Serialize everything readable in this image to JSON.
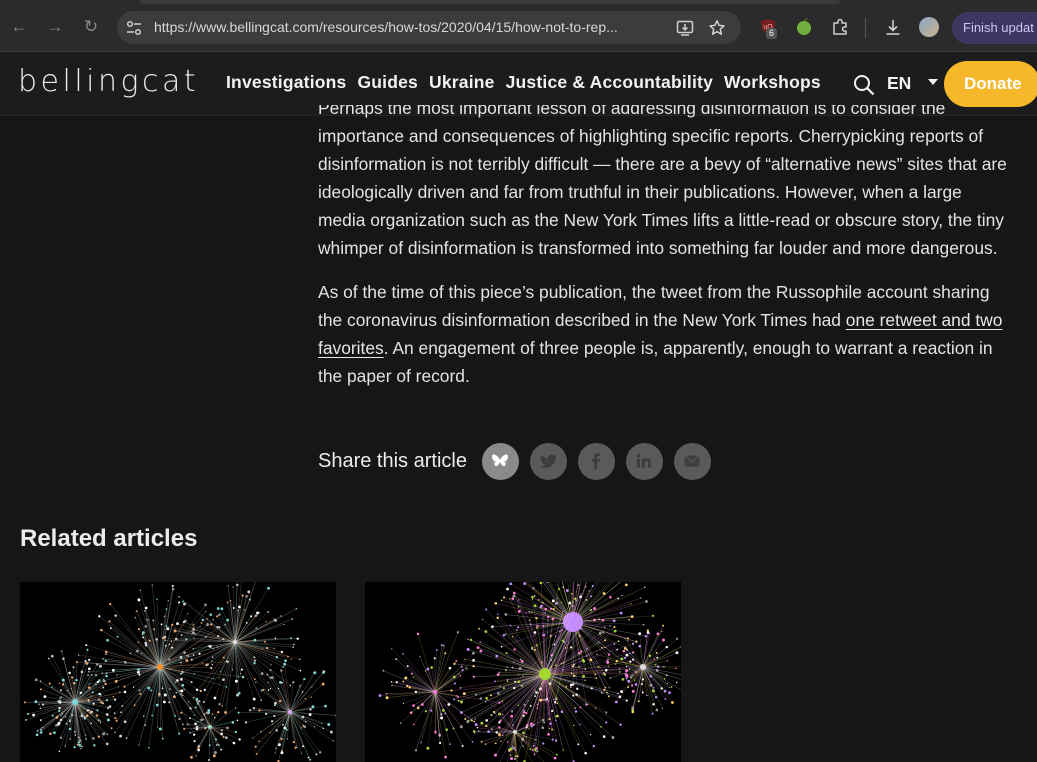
{
  "browser": {
    "url": "https://www.bellingcat.com/resources/how-tos/2020/04/15/how-not-to-rep...",
    "extension_badge": "6",
    "finish_update_label": "Finish updat"
  },
  "site": {
    "logo": "bellingcat",
    "nav": [
      "Investigations",
      "Guides",
      "Ukraine",
      "Justice & Accountability",
      "Workshops"
    ],
    "language": "EN",
    "donate_label": "Donate",
    "accent": "#f6b82a"
  },
  "article": {
    "para1_lines": [
      "Perhaps the most important lesson of addressing disinformation is to consider the",
      "importance and consequences of highlighting specific reports. Cherrypicking reports of",
      "disinformation is not terribly difficult — there are a bevy of “alternative news” sites that are",
      "ideologically driven and far from truthful in their publications. However, when a large",
      "media organization such as the New York Times lifts a little-read or obscure story, the tiny",
      "whimper of disinformation is transformed into something far louder and more dangerous."
    ],
    "para2": {
      "line1": "As of the time of this piece’s publication, the tweet from the Russophile account sharing",
      "line2_prefix": "the coronavirus disinformation described in the New York Times had ",
      "link_part1": "one retweet and two",
      "link_part2": "favorites",
      "line3_suffix": ". An engagement of three people is, apparently, enough to warrant a reaction in",
      "line4": "the paper of record."
    }
  },
  "share": {
    "label": "Share this article",
    "buttons": [
      "bluesky-icon",
      "twitter-icon",
      "facebook-icon",
      "linkedin-icon",
      "email-icon"
    ]
  },
  "related": {
    "title": "Related articles"
  }
}
